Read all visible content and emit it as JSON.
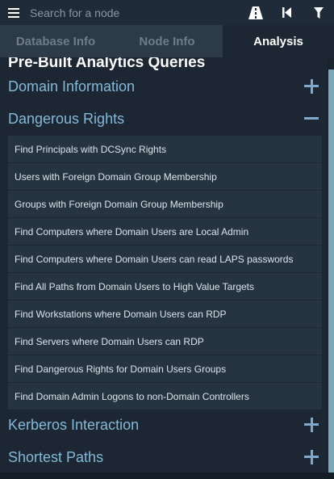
{
  "search": {
    "placeholder": "Search for a node"
  },
  "icons": {
    "menu": "hamburger-menu-icon",
    "pathfinding": "pathfinding-road-icon",
    "back": "back-step-icon",
    "filter": "filter-funnel-icon"
  },
  "tabs": [
    {
      "label": "Database Info",
      "active": false
    },
    {
      "label": "Node Info",
      "active": false
    },
    {
      "label": "Analysis",
      "active": true
    }
  ],
  "analysis": {
    "heading": "Pre-Built Analytics Queries",
    "categories": [
      {
        "label": "Domain Information",
        "expanded": false
      },
      {
        "label": "Dangerous Rights",
        "expanded": true
      },
      {
        "label": "Kerberos Interaction",
        "expanded": false
      },
      {
        "label": "Shortest Paths",
        "expanded": false
      }
    ],
    "queries": [
      "Find Principals with DCSync Rights",
      "Users with Foreign Domain Group Membership",
      "Groups with Foreign Domain Group Membership",
      "Find Computers where Domain Users are Local Admin",
      "Find Computers where Domain Users can read LAPS passwords",
      "Find All Paths from Domain Users to High Value Targets",
      "Find Workstations where Domain Users can RDP",
      "Find Servers where Domain Users can RDP",
      "Find Dangerous Rights for Domain Users Groups",
      "Find Domain Admin Logons to non-Domain Controllers"
    ]
  },
  "colors": {
    "accent": "#84b8d8",
    "background": "#1c2733",
    "scrollbar": "#7ea9bd"
  }
}
